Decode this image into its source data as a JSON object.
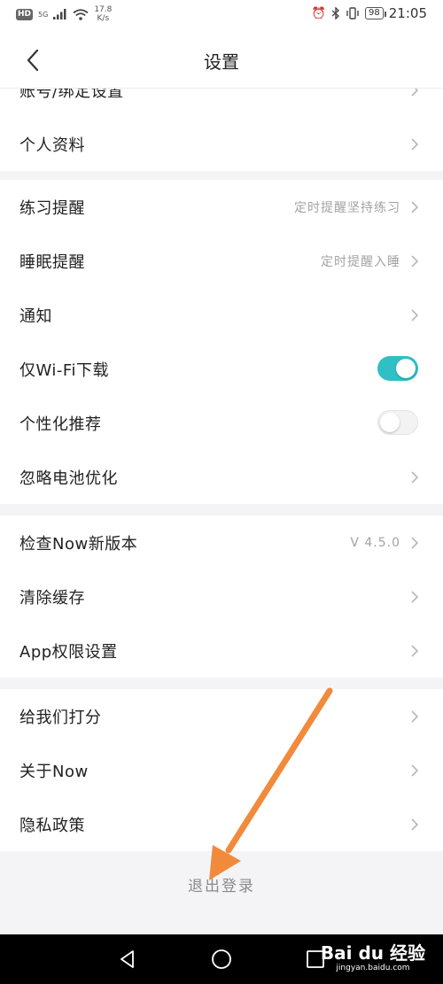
{
  "status_bar": {
    "hd": "HD",
    "signal_gen": "5G",
    "speed_value": "17.8",
    "speed_unit": "K/s",
    "battery": "98",
    "time": "21:05"
  },
  "header": {
    "title": "设置"
  },
  "groups": [
    {
      "rows": [
        {
          "label": "账号/绑定设置",
          "type": "chevron"
        },
        {
          "label": "个人资料",
          "type": "chevron"
        }
      ]
    },
    {
      "rows": [
        {
          "label": "练习提醒",
          "value": "定时提醒坚持练习",
          "type": "chevron"
        },
        {
          "label": "睡眠提醒",
          "value": "定时提醒入睡",
          "type": "chevron"
        },
        {
          "label": "通知",
          "type": "chevron"
        },
        {
          "label": "仅Wi-Fi下载",
          "type": "toggle",
          "on": true
        },
        {
          "label": "个性化推荐",
          "type": "toggle",
          "on": false
        },
        {
          "label": "忽略电池优化",
          "type": "chevron"
        }
      ]
    },
    {
      "rows": [
        {
          "label": "检查Now新版本",
          "value": "V 4.5.0",
          "type": "chevron"
        },
        {
          "label": "清除缓存",
          "type": "chevron"
        },
        {
          "label": "App权限设置",
          "type": "chevron"
        }
      ]
    },
    {
      "rows": [
        {
          "label": "给我们打分",
          "type": "chevron"
        },
        {
          "label": "关于Now",
          "type": "chevron"
        },
        {
          "label": "隐私政策",
          "type": "chevron"
        }
      ]
    }
  ],
  "logout_label": "退出登录",
  "colors": {
    "accent": "#2fbfc5",
    "annotation_arrow": "#f28a3c",
    "background": "#f4f4f6"
  },
  "watermark": {
    "brand": "Bai du 经验",
    "site": "jingyan.baidu.com"
  }
}
